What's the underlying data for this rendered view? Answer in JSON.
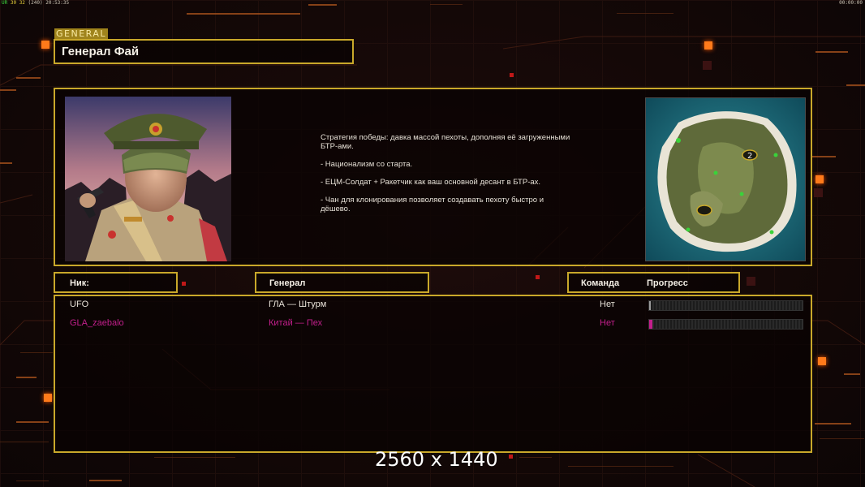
{
  "topbar": {
    "left_prefix": "UR",
    "left_values": "30 32",
    "left_extra": "(240)",
    "left_time": "20:53:35",
    "right_time": "00:00:00"
  },
  "general_tag": "GENERAL",
  "title": "Генерал Фай",
  "description": [
    "Стратегия победы: давка массой пехоты, дополняя её загруженными БТР-ами.",
    "- Национализм со старта.",
    "- ЕЦМ-Солдат + Ракетчик как ваш основной десант в БТР-ах.",
    "- Чан для клонирования позволяет создавать пехоту быстро и дёшево."
  ],
  "headers": {
    "nick": "Ник:",
    "general": "Генерал",
    "team": "Команда",
    "progress": "Прогресс"
  },
  "players": [
    {
      "nick": "UFO",
      "general": "ГЛА — Штурм",
      "team": "Нет",
      "progress": 0.01,
      "color": "#e8e2d8"
    },
    {
      "nick": "GLA_zaebalo",
      "general": "Китай — Пех",
      "team": "Нет",
      "progress": 0.02,
      "color": "#c31f8c"
    }
  ],
  "minimap": {
    "marker_label": "2"
  },
  "resolution_label": "2560 x 1440",
  "colors": {
    "frame": "#c9a82a",
    "accent_orange": "#ff7a1a",
    "player2": "#c31f8c"
  }
}
